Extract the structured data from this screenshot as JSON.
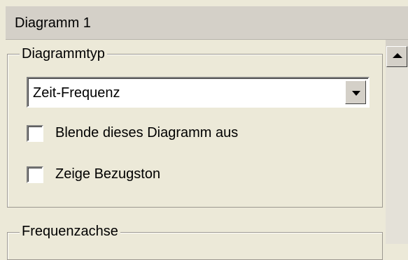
{
  "panel": {
    "title": "Diagramm 1"
  },
  "diagram_type_group": {
    "legend": "Diagrammtyp",
    "dropdown": {
      "selected": "Zeit-Frequenz"
    },
    "checkboxes": [
      {
        "label": "Blende dieses Diagramm aus",
        "checked": false
      },
      {
        "label": "Zeige Bezugston",
        "checked": false
      }
    ]
  },
  "frequency_axis_group": {
    "legend": "Frequenzachse"
  },
  "icons": {
    "dropdown_arrow": "chevron-down-icon",
    "scroll_up_arrow": "chevron-up-icon"
  },
  "colors": {
    "panel_bg": "#ece9d8",
    "header_bg": "#d4d0c8"
  }
}
